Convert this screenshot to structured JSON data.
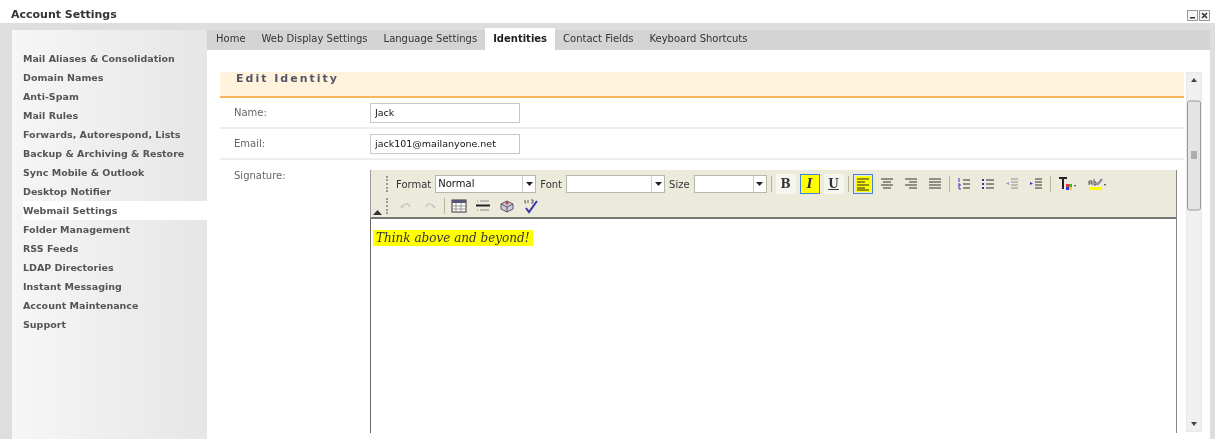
{
  "window": {
    "title": "Account Settings"
  },
  "sidebar": {
    "items": [
      {
        "label": "Mail Aliases & Consolidation",
        "selected": false
      },
      {
        "label": "Domain Names",
        "selected": false
      },
      {
        "label": "Anti-Spam",
        "selected": false
      },
      {
        "label": "Mail Rules",
        "selected": false
      },
      {
        "label": "Forwards, Autorespond, Lists",
        "selected": false
      },
      {
        "label": "Backup & Archiving & Restore",
        "selected": false
      },
      {
        "label": "Sync Mobile & Outlook",
        "selected": false
      },
      {
        "label": "Desktop Notifier",
        "selected": false
      },
      {
        "label": "Webmail Settings",
        "selected": true
      },
      {
        "label": "Folder Management",
        "selected": false
      },
      {
        "label": "RSS Feeds",
        "selected": false
      },
      {
        "label": "LDAP Directories",
        "selected": false
      },
      {
        "label": "Instant Messaging",
        "selected": false
      },
      {
        "label": "Account Maintenance",
        "selected": false
      },
      {
        "label": "Support",
        "selected": false
      }
    ]
  },
  "tabs": [
    {
      "label": "Home",
      "selected": false
    },
    {
      "label": "Web Display Settings",
      "selected": false
    },
    {
      "label": "Language Settings",
      "selected": false
    },
    {
      "label": "Identities",
      "selected": true
    },
    {
      "label": "Contact Fields",
      "selected": false
    },
    {
      "label": "Keyboard Shortcuts",
      "selected": false
    }
  ],
  "panel": {
    "title": "Edit Identity",
    "fields": [
      {
        "label": "Name:",
        "value": "Jack"
      },
      {
        "label": "Email:",
        "value": "jack101@mailanyone.net"
      }
    ],
    "signature": {
      "label": "Signature:",
      "toolbar_rows": [
        [
          {
            "kind": "combo",
            "label": "Format",
            "value": "Normal"
          },
          {
            "kind": "combo",
            "label": "Font"
          },
          {
            "kind": "combo",
            "label": "Size"
          },
          {
            "kind": "separator"
          },
          {
            "kind": "letter",
            "text": "B",
            "selected": false
          },
          {
            "kind": "letter",
            "text": "I",
            "selected": true
          },
          {
            "kind": "letter",
            "text": "U",
            "selected": false
          },
          {
            "kind": "separator"
          },
          {
            "kind": "icon",
            "selected": true,
            "disabled": false
          },
          {
            "kind": "icon",
            "selected": false,
            "disabled": false
          },
          {
            "kind": "icon",
            "selected": false,
            "disabled": false
          },
          {
            "kind": "icon",
            "selected": false,
            "disabled": false
          },
          {
            "kind": "separator"
          },
          {
            "kind": "icon",
            "selected": false,
            "disabled": false
          },
          {
            "kind": "icon",
            "selected": false,
            "disabled": false
          },
          {
            "kind": "icon",
            "selected": false,
            "disabled": true
          },
          {
            "kind": "icon",
            "selected": false,
            "disabled": false
          },
          {
            "kind": "separator"
          },
          {
            "kind": "icon",
            "selected": false,
            "disabled": false
          },
          {
            "kind": "icon",
            "selected": false,
            "disabled": false
          }
        ],
        [
          {
            "kind": "icon",
            "disabled": true
          },
          {
            "kind": "icon",
            "disabled": true
          },
          {
            "kind": "separator"
          },
          {
            "kind": "icon",
            "disabled": false
          },
          {
            "kind": "icon",
            "disabled": false
          },
          {
            "kind": "icon",
            "disabled": false
          },
          {
            "kind": "icon",
            "disabled": false
          }
        ]
      ],
      "text": "Think above and beyond!"
    }
  }
}
